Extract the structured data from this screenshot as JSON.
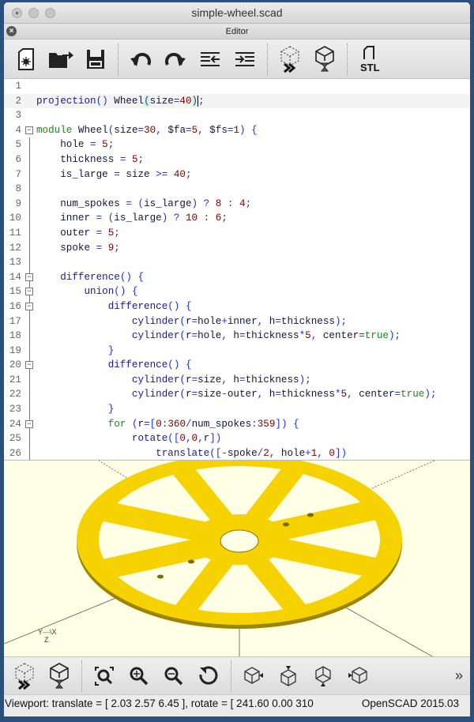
{
  "window": {
    "title": "simple-wheel.scad"
  },
  "editor_dock": {
    "title": "Editor"
  },
  "toolbar": [
    {
      "name": "new-file",
      "icon": "new-file-icon"
    },
    {
      "name": "open-file",
      "icon": "open-folder-icon"
    },
    {
      "name": "save",
      "icon": "save-icon"
    },
    {
      "name": "undo",
      "icon": "undo-icon"
    },
    {
      "name": "redo",
      "icon": "redo-icon"
    },
    {
      "name": "unindent",
      "icon": "unindent-icon"
    },
    {
      "name": "indent",
      "icon": "indent-icon"
    },
    {
      "name": "preview",
      "icon": "preview-icon"
    },
    {
      "name": "render",
      "icon": "render-icon"
    },
    {
      "name": "export-stl",
      "icon": "stl-icon",
      "label": "STL"
    }
  ],
  "code_lines": [
    "",
    "projection() Wheel(size=40);",
    "",
    "module Wheel(size=30, $fa=5, $fs=1) {",
    "    hole = 5;",
    "    thickness = 5;",
    "    is_large = size >= 40;",
    "",
    "    num_spokes = (is_large) ? 8 : 4;",
    "    inner = (is_large) ? 10 : 6;",
    "    outer = 5;",
    "    spoke = 9;",
    "",
    "    difference() {",
    "        union() {",
    "            difference() {",
    "                cylinder(r=hole+inner, h=thickness);",
    "                cylinder(r=hole, h=thickness*5, center=true);",
    "            }",
    "            difference() {",
    "                cylinder(r=size, h=thickness);",
    "                cylinder(r=size-outer, h=thickness*5, center=true);",
    "            }",
    "            for (r=[0:360/num_spokes:359]) {",
    "                rotate([0,0,r])",
    "                    translate([-spoke/2, hole+1, 0])"
  ],
  "current_line": 2,
  "colors": {
    "model": "#f5d200",
    "background": "#ffffe5"
  },
  "view_toolbar": [
    {
      "name": "preview",
      "icon": "preview-icon"
    },
    {
      "name": "render",
      "icon": "render-icon"
    },
    {
      "name": "view-all",
      "icon": "zoom-fit-icon"
    },
    {
      "name": "zoom-in",
      "icon": "zoom-in-icon"
    },
    {
      "name": "zoom-out",
      "icon": "zoom-out-icon"
    },
    {
      "name": "reset-view",
      "icon": "reset-view-icon"
    },
    {
      "name": "view-right",
      "icon": "view-right-icon"
    },
    {
      "name": "view-top",
      "icon": "view-top-icon"
    },
    {
      "name": "view-bottom",
      "icon": "view-bottom-icon"
    },
    {
      "name": "view-left",
      "icon": "view-left-icon"
    },
    {
      "name": "more",
      "icon": "overflow-chevron-icon",
      "label": "»"
    }
  ],
  "axes": {
    "x": "X",
    "y": "Y",
    "z": "Z"
  },
  "status": {
    "viewport": "Viewport: translate = [ 2.03 2.57 6.45 ], rotate = [ 241.60 0.00 310",
    "version": "OpenSCAD 2015.03"
  }
}
